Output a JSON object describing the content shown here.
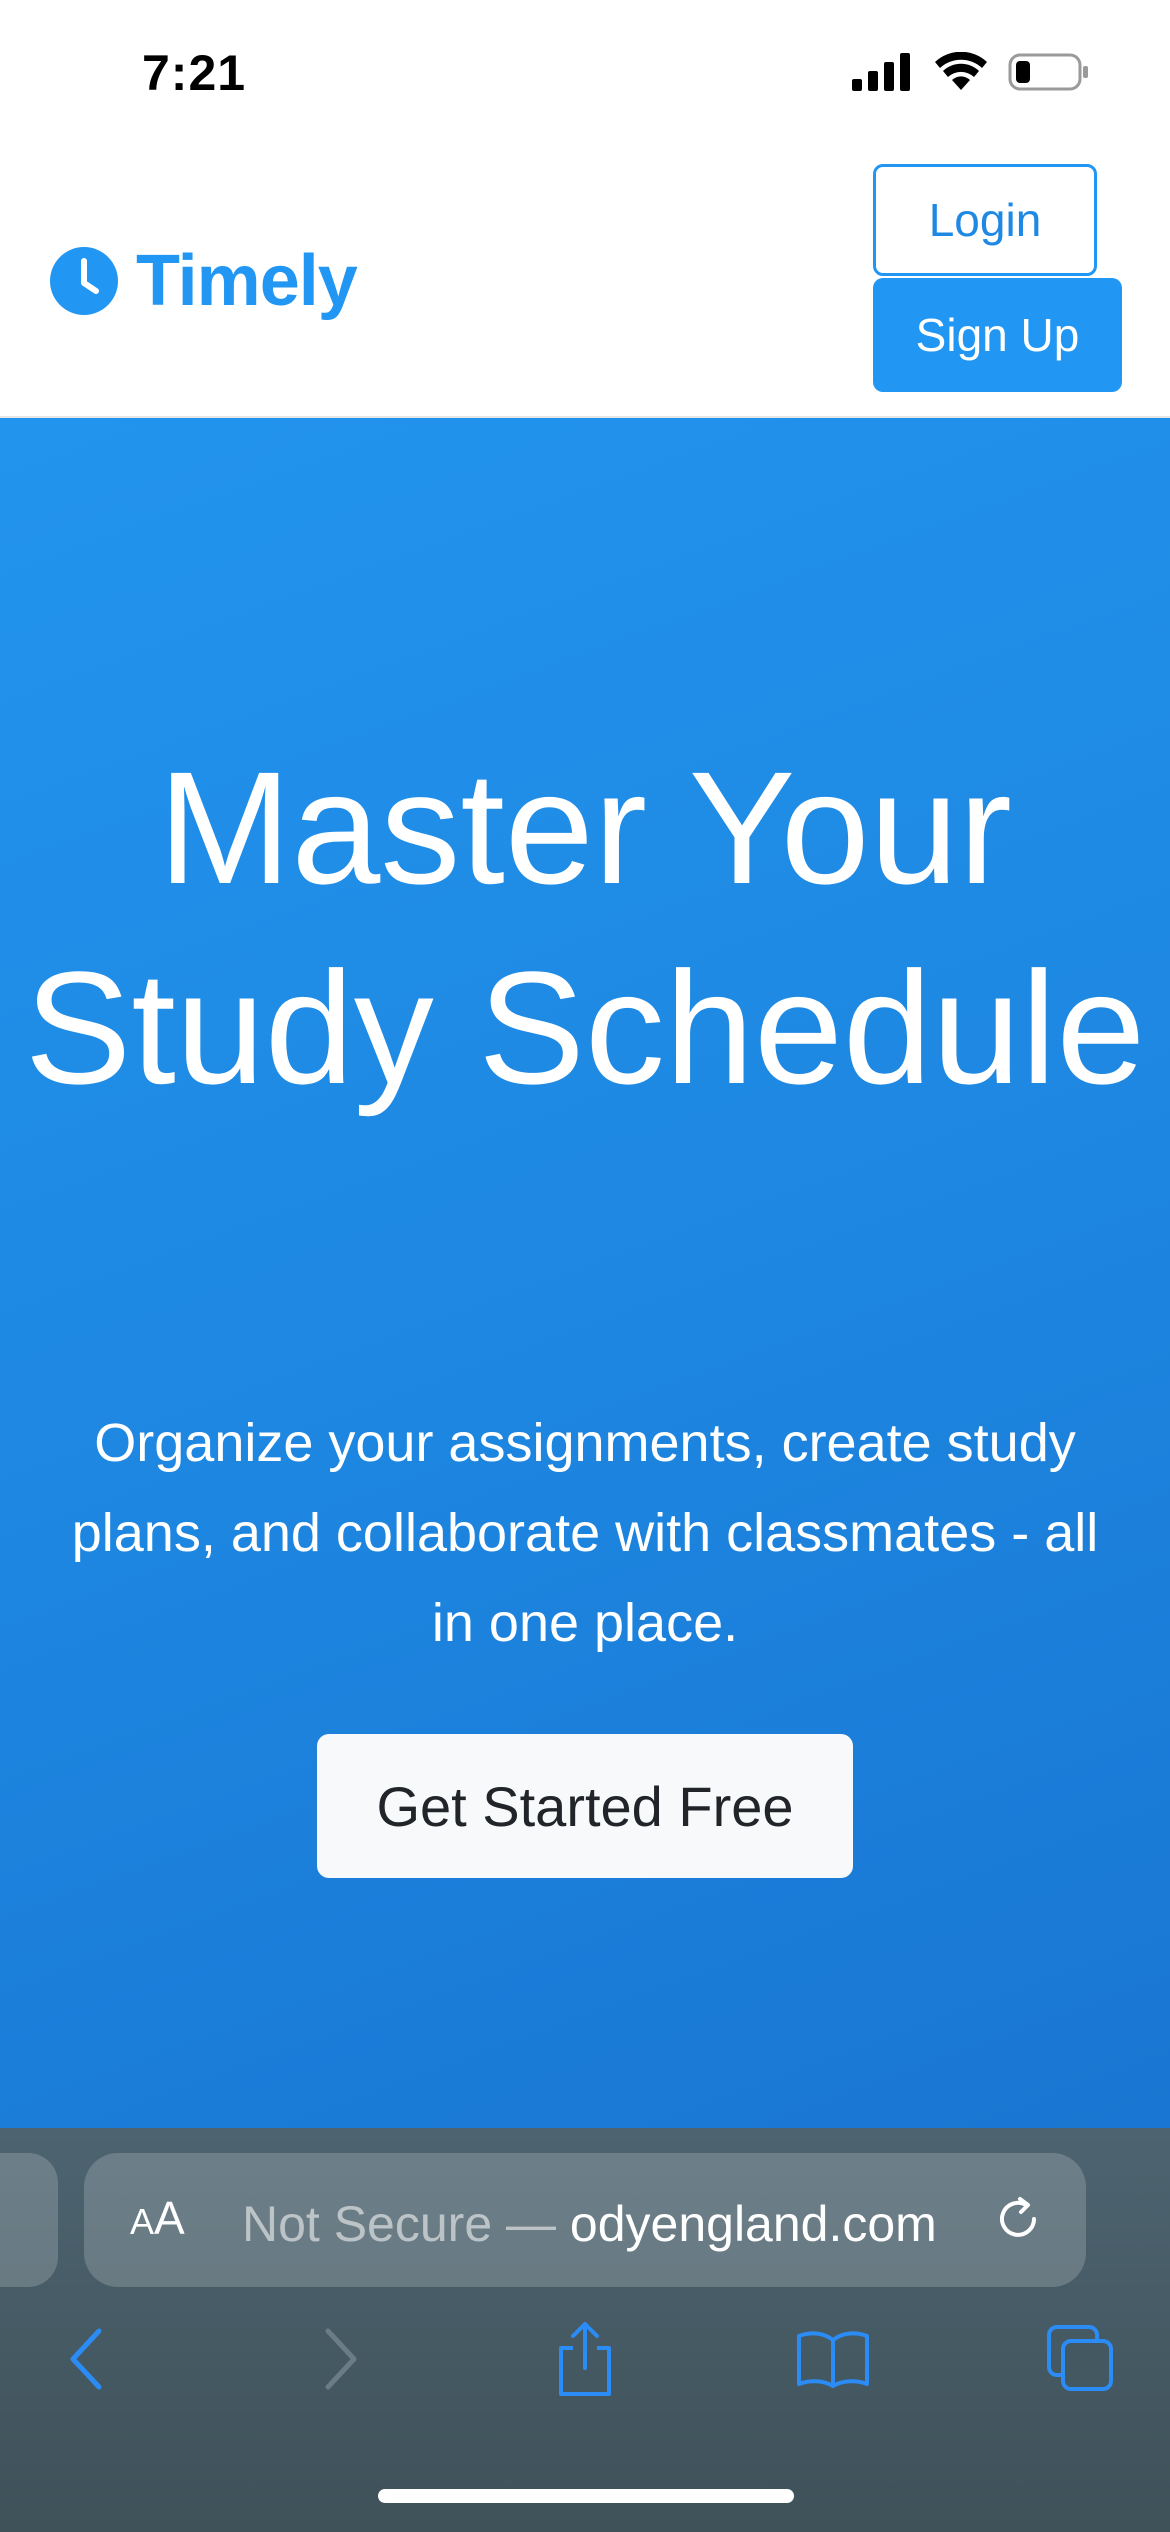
{
  "status_bar": {
    "time": "7:21"
  },
  "header": {
    "logo_text": "Timely",
    "login_label": "Login",
    "signup_label": "Sign Up"
  },
  "hero": {
    "title": "Master Your Study Schedule",
    "subtitle": "Organize your assignments, create study plans, and collaborate with classmates - all in one place.",
    "cta_label": "Get Started Free"
  },
  "browser": {
    "aa_small": "A",
    "aa_large": "A",
    "url_prefix": "Not Secure — ",
    "url_domain": "odyengland.com"
  },
  "colors": {
    "brand": "#2196f3",
    "hero_gradient_start": "#2294ee",
    "hero_gradient_end": "#1976d2",
    "cta_background": "#f8f9fa",
    "browser_toolbar": "#4d6470",
    "toolbar_icon": "#2b8cf5"
  },
  "icons": {
    "status": [
      "cellular-signal-icon",
      "wifi-icon",
      "battery-icon"
    ],
    "logo": "clock-icon",
    "browser": [
      "reload-icon",
      "back-icon",
      "forward-icon",
      "share-icon",
      "bookmarks-icon",
      "tabs-icon"
    ]
  }
}
